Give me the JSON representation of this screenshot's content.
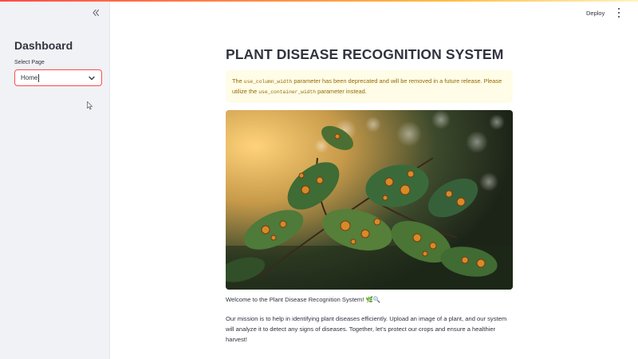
{
  "sidebar": {
    "title": "Dashboard",
    "select_label": "Select Page",
    "select_value": "Home"
  },
  "header": {
    "deploy_label": "Deploy"
  },
  "main": {
    "title": "PLANT DISEASE RECOGNITION SYSTEM",
    "warning": {
      "text_1": "The ",
      "code_1": "use_column_width",
      "text_2": " parameter has been deprecated and will be removed in a future release. Please utilize the ",
      "code_2": "use_container_width",
      "text_3": " parameter instead."
    },
    "welcome": "Welcome to the Plant Disease Recognition System! 🌿🔍",
    "mission": "Our mission is to help in identifying plant diseases efficiently. Upload an image of a plant, and our system will analyze it to detect any signs of diseases. Together, let's protect our crops and ensure a healthier harvest!"
  },
  "colors": {
    "accent": "#ff4b4b",
    "sidebar_bg": "#f0f2f6",
    "warning_bg": "#fffce7",
    "warning_text": "#926c05"
  },
  "icons": {
    "collapse": "double-chevron-left-icon",
    "select_arrow": "chevron-down-icon",
    "menu": "vertical-ellipsis-icon"
  }
}
